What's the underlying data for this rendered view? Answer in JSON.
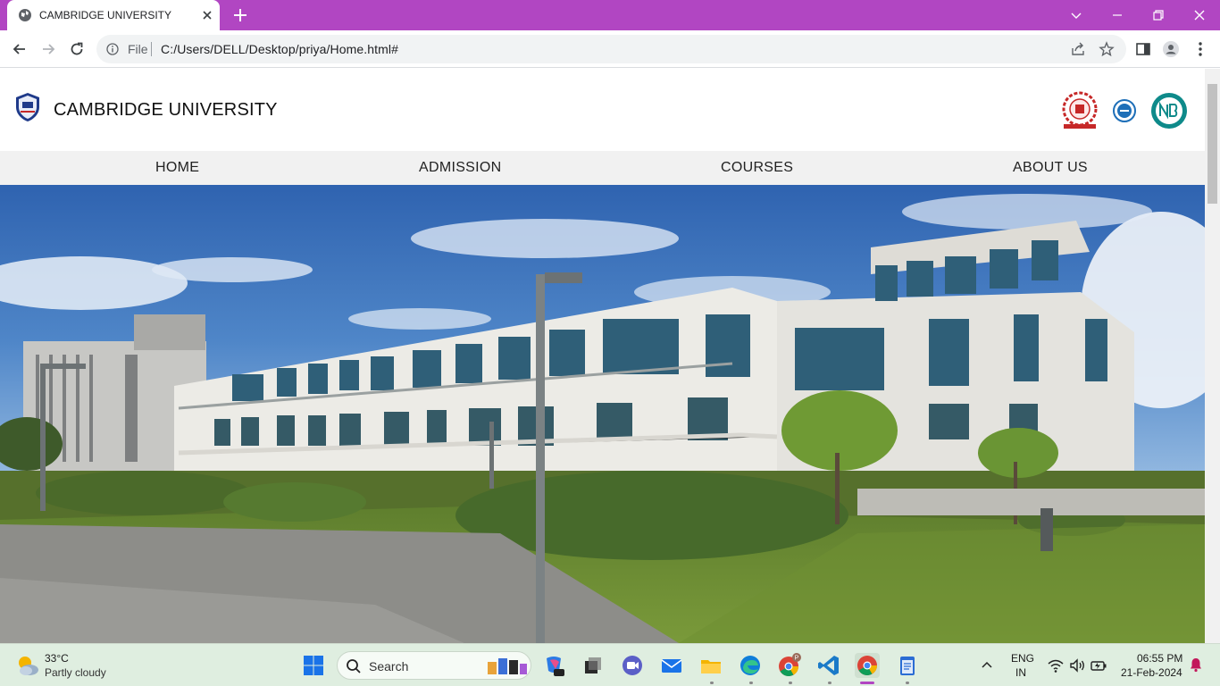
{
  "browser": {
    "tab_title": "CAMBRIDGE UNIVERSITY",
    "file_label": "File",
    "url": "C:/Users/DELL/Desktop/priya/Home.html#",
    "accent_color": "#b146c2"
  },
  "site": {
    "name": "CAMBRIDGE UNIVERSITY",
    "nav": [
      "HOME",
      "ADMISSION",
      "COURSES",
      "ABOUT US"
    ],
    "badges": [
      "emblem-badge",
      "iso-badge",
      "nba-badge"
    ],
    "hero_image": "university-building-photo"
  },
  "taskbar": {
    "weather_temp": "33°C",
    "weather_desc": "Partly cloudy",
    "search_label": "Search",
    "chrome_profile_badge": "P",
    "lang_line1": "ENG",
    "lang_line2": "IN",
    "time": "06:55 PM",
    "date": "21-Feb-2024"
  }
}
